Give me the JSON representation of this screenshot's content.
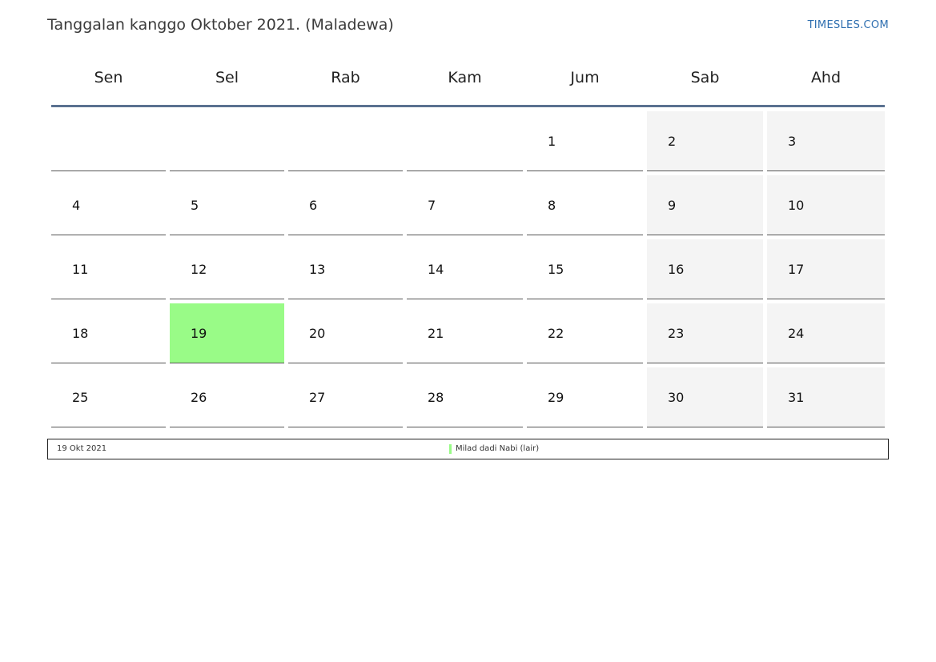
{
  "header": {
    "title": "Tanggalan kanggo Oktober 2021. (Maladewa)",
    "site_link": "TIMESLES.COM"
  },
  "weekdays": [
    "Sen",
    "Sel",
    "Rab",
    "Kam",
    "Jum",
    "Sab",
    "Ahd"
  ],
  "weeks": [
    [
      "",
      "",
      "",
      "",
      "1",
      "2",
      "3"
    ],
    [
      "4",
      "5",
      "6",
      "7",
      "8",
      "9",
      "10"
    ],
    [
      "11",
      "12",
      "13",
      "14",
      "15",
      "16",
      "17"
    ],
    [
      "18",
      "19",
      "20",
      "21",
      "22",
      "23",
      "24"
    ],
    [
      "25",
      "26",
      "27",
      "28",
      "29",
      "30",
      "31"
    ]
  ],
  "highlighted_day": "19",
  "colors": {
    "weekend_fill": "#f4f4f4",
    "holiday_fill": "#99fb87",
    "header_rule": "#5a7190",
    "link": "#2f6fb0"
  },
  "legend": [
    {
      "date": "19 Okt 2021",
      "name": "Milad dadi Nabi (lair)"
    }
  ]
}
